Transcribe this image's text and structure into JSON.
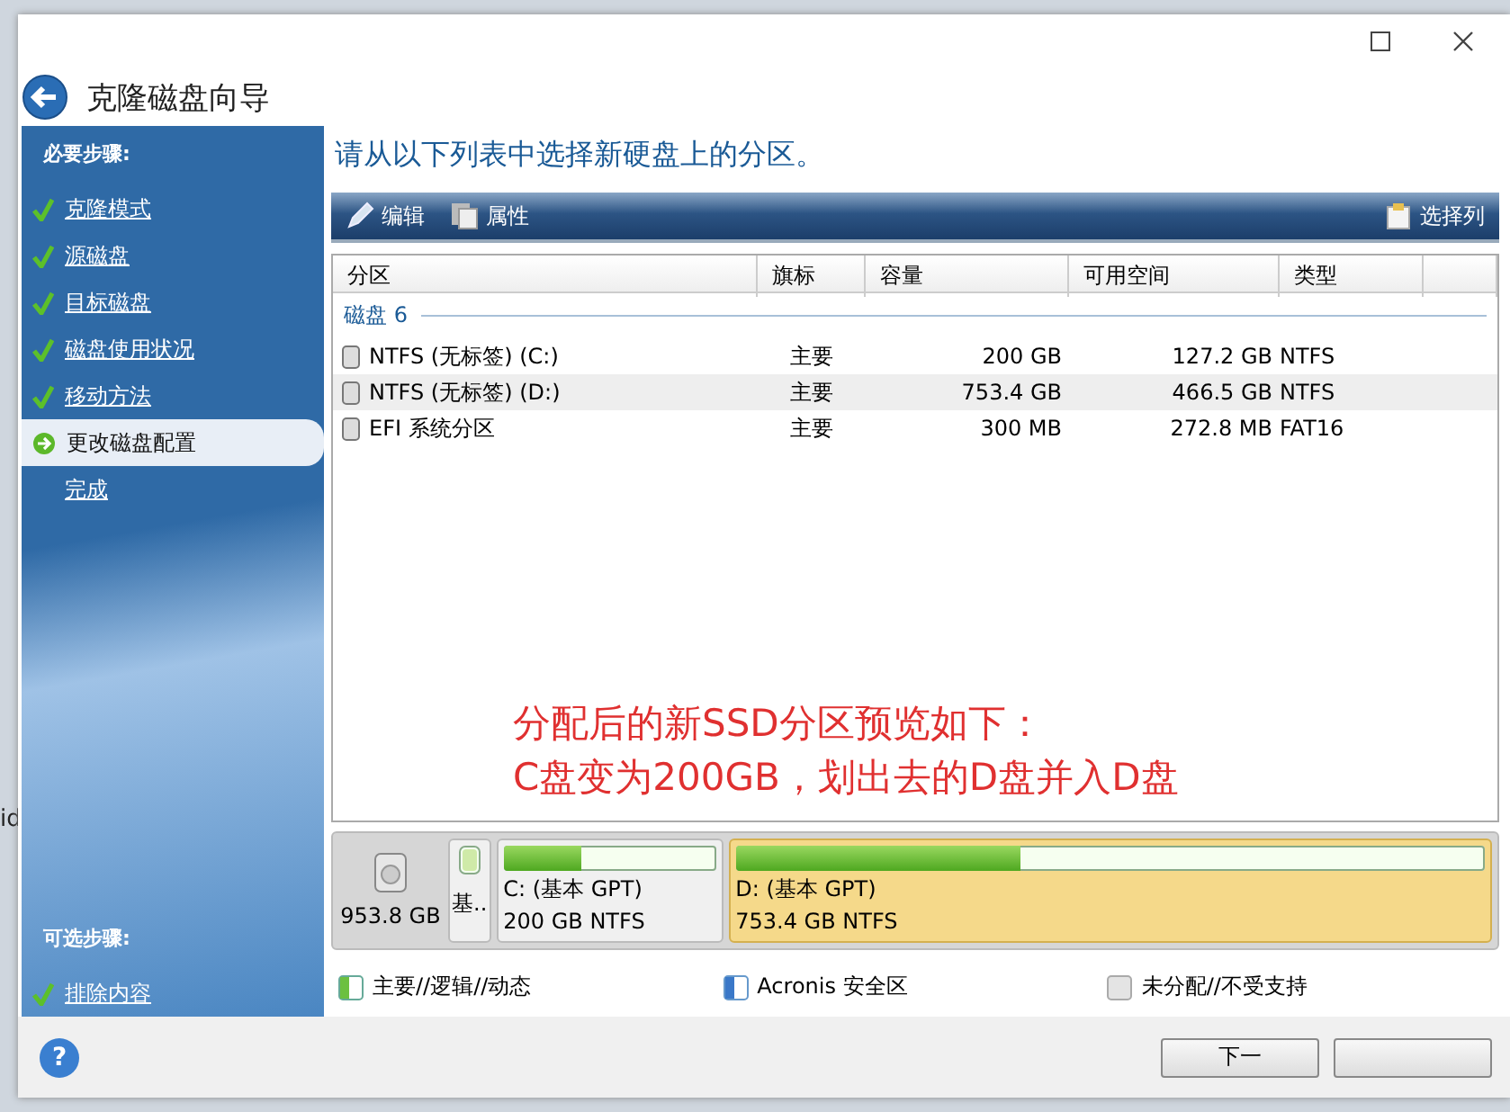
{
  "background": {
    "fragment_text": "id"
  },
  "window": {
    "title": "克隆磁盘向导"
  },
  "sidebar": {
    "required_heading": "必要步骤:",
    "steps": [
      {
        "label": "克隆模式",
        "done": true,
        "selected": false
      },
      {
        "label": "源磁盘",
        "done": true,
        "selected": false
      },
      {
        "label": "目标磁盘",
        "done": true,
        "selected": false
      },
      {
        "label": "磁盘使用状况",
        "done": true,
        "selected": false
      },
      {
        "label": "移动方法",
        "done": true,
        "selected": false
      },
      {
        "label": "更改磁盘配置",
        "done": false,
        "selected": true
      },
      {
        "label": "完成",
        "done": false,
        "selected": false
      }
    ],
    "optional_heading": "可选步骤:",
    "optional_steps": [
      {
        "label": "排除内容",
        "done": true,
        "selected": false
      }
    ]
  },
  "content": {
    "instruction": "请从以下列表中选择新硬盘上的分区。",
    "toolbar": {
      "left": [
        {
          "label": "编辑",
          "kind": "edit"
        },
        {
          "label": "属性",
          "kind": "properties"
        }
      ],
      "right": [
        {
          "label": "选择列",
          "kind": "columns"
        }
      ]
    },
    "table": {
      "columns": [
        "分区",
        "旗标",
        "容量",
        "可用空间",
        "类型"
      ],
      "groups": [
        {
          "label": "磁盘 6",
          "rows": [
            {
              "cells": [
                "NTFS (无标签) (C:)",
                "主要",
                "200 GB",
                "127.2 GB",
                "NTFS"
              ],
              "selected": false
            },
            {
              "cells": [
                "NTFS (无标签) (D:)",
                "主要",
                "753.4 GB",
                "466.5 GB",
                "NTFS"
              ],
              "selected": true
            },
            {
              "cells": [
                "EFI 系统分区",
                "主要",
                "300 MB",
                "272.8 MB",
                "FAT16"
              ],
              "selected": false
            }
          ]
        }
      ]
    },
    "annotation": [
      "分配后的新SSD分区预览如下：",
      "C盘变为200GB，划出去的D盘并入D盘"
    ],
    "disk_map": {
      "size": "953.8 GB",
      "partitions": [
        {
          "kind": "small",
          "label": "基..",
          "selected": false
        },
        {
          "kind": "normal",
          "label": "C: (基本 GPT)",
          "detail": "200 GB   NTFS",
          "level": 0.37,
          "selected": false
        },
        {
          "kind": "normal",
          "label": "D: (基本 GPT)",
          "detail": "753.4 GB   NTFS",
          "level": 0.38,
          "selected": true
        }
      ]
    },
    "legend": [
      {
        "label": "主要//逻辑//动态",
        "kind": "primary"
      },
      {
        "label": "Acronis 安全区",
        "kind": "secure"
      },
      {
        "label": "未分配//不受支持",
        "kind": "unallocated"
      }
    ]
  },
  "footer": {
    "help": "?",
    "buttons": [
      {
        "label": "下一"
      }
    ]
  }
}
